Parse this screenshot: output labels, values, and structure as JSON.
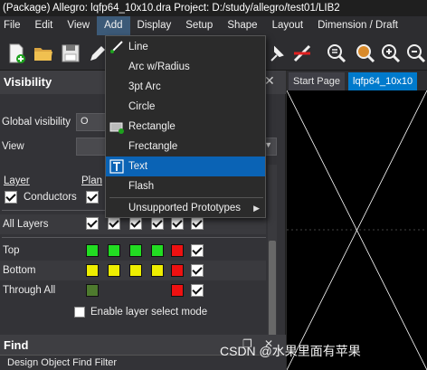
{
  "window": {
    "title": "(Package) Allegro: lqfp64_10x10.dra  Project: D:/study/allegro/test01/LIB2"
  },
  "menubar": {
    "items": [
      "File",
      "Edit",
      "View",
      "Add",
      "Display",
      "Setup",
      "Shape",
      "Layout",
      "Dimension / Draft"
    ],
    "active": "Add"
  },
  "toolbar": {
    "icons": [
      "new-file-icon",
      "open-folder-icon",
      "save-icon",
      "pencil-icon",
      "pin-icon",
      "cross-out-icon",
      "zoom-fit-icon",
      "zoom-window-icon",
      "zoom-in-icon",
      "zoom-out-icon"
    ]
  },
  "add_menu": {
    "items": [
      {
        "label": "Line",
        "icon": "line-icon"
      },
      {
        "label": "Arc w/Radius",
        "icon": ""
      },
      {
        "label": "3pt Arc",
        "icon": ""
      },
      {
        "label": "Circle",
        "icon": ""
      },
      {
        "label": "Rectangle",
        "icon": "rectangle-icon"
      },
      {
        "label": "Frectangle",
        "icon": ""
      },
      {
        "label": "Text",
        "icon": "text-icon",
        "highlighted": true
      },
      {
        "label": "Flash",
        "icon": ""
      },
      {
        "label": "Unsupported Prototypes",
        "icon": "",
        "submenu": true
      }
    ],
    "highlight_color": "#0a63b5"
  },
  "visibility": {
    "title": "Visibility",
    "global_visibility_label": "Global visibility",
    "global_visibility_button_text": "O",
    "view_label": "View",
    "layer_header": "Layer",
    "plan_header": "Plan",
    "conductors_label": "Conductors",
    "all_layers_label": "All Layers",
    "rows": [
      {
        "label": "Top",
        "colors": [
          "#22dd22",
          "#22dd22",
          "#22dd22",
          "#22dd22",
          "#ee1111"
        ]
      },
      {
        "label": "Bottom",
        "colors": [
          "#eeee00",
          "#eeee00",
          "#eeee00",
          "#eeee00",
          "#ee1111"
        ]
      },
      {
        "label": "Through All",
        "colors": [
          "#4e7a2e",
          "",
          "",
          "",
          "#ee1111"
        ]
      }
    ],
    "enable_layer_select_label": "Enable layer select mode"
  },
  "find": {
    "title": "Find",
    "filter_label": "Design Object Find Filter"
  },
  "canvas": {
    "tabs": [
      "Start Page",
      "lqfp64_10x10"
    ],
    "active_tab": "lqfp64_10x10"
  },
  "watermark": "CSDN @水果里面有苹果"
}
